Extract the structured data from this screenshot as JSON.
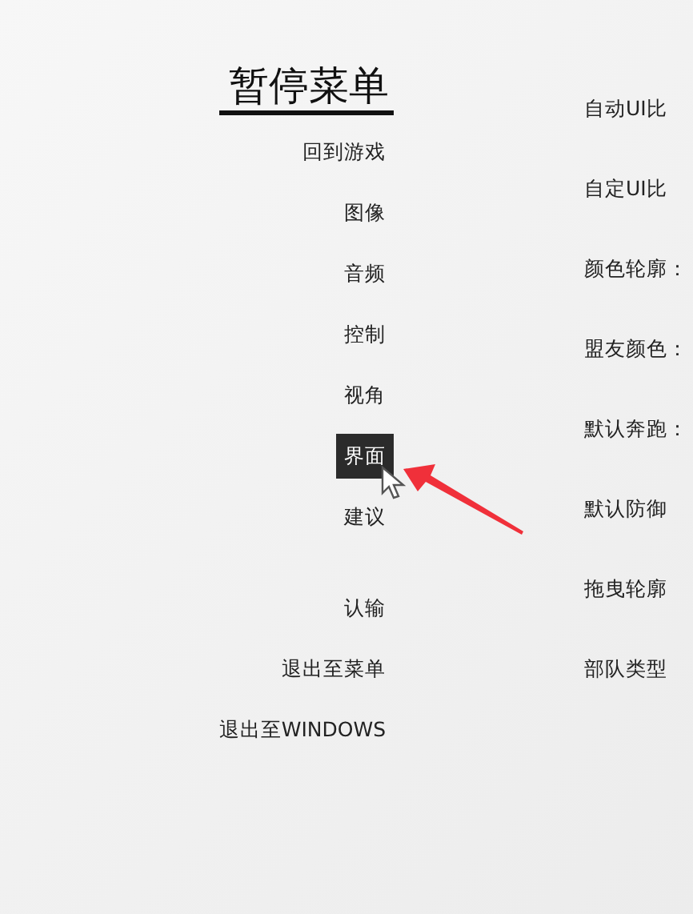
{
  "title": "暂停菜单",
  "menu_groups": [
    {
      "items": [
        {
          "label": "回到游戏",
          "selected": false
        },
        {
          "label": "图像",
          "selected": false
        },
        {
          "label": "音频",
          "selected": false
        },
        {
          "label": "控制",
          "selected": false
        },
        {
          "label": "视角",
          "selected": false
        },
        {
          "label": "界面",
          "selected": true
        },
        {
          "label": "建议",
          "selected": false
        }
      ]
    },
    {
      "items": [
        {
          "label": "认输",
          "selected": false
        },
        {
          "label": "退出至菜单",
          "selected": false
        },
        {
          "label": "退出至WINDOWS",
          "selected": false
        }
      ]
    }
  ],
  "settings": [
    {
      "label": "自动UI比"
    },
    {
      "label": "自定UI比"
    },
    {
      "label": "颜色轮廓："
    },
    {
      "label": "盟友颜色："
    },
    {
      "label": "默认奔跑："
    },
    {
      "label": "默认防御"
    },
    {
      "label": "拖曳轮廓"
    },
    {
      "label": "部队类型"
    }
  ]
}
